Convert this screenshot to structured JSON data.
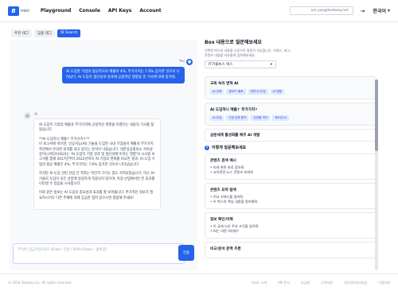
{
  "app": {
    "logo_mark": "B",
    "logo_text": "mini"
  },
  "nav": {
    "items": [
      "Playground",
      "Console",
      "API Keys",
      "Account"
    ],
    "email": "sm.yoo@testwoy.net",
    "language": "한국어"
  },
  "left": {
    "tabs": [
      "추천 태그",
      "맞춤 태그",
      "IB Search"
    ],
    "user_label": "You",
    "user_message": "AI 도입한 기업의 평균적으로 매출이 4%, 부가가치는 7.6% 증가한 것으로 나타났다. AI 도입이 생산성과 성과에 긍정적인 영향을 준 기사에 대해 알려줘.",
    "ai_label": "AI",
    "ai_paragraphs": [
      "AI 도입이 기업의 매출과 부가가치에 긍정적인 영향을 미쳤다는 내용의 기사를 찾았습니다.",
      "**AI 도입하니 매출↑ 부가가치↑**\n이 보고서에 따르면, 인공지능(AI) 기술을 도입한 국내 기업들이 매출과 부가가치 측면에서 유의한 성과를 내고 있다는 분석이 나왔습니다. 대한상공회의소 지속성장이니셔티브(SGI)는 'AI 도입이 기업 성과 및 생산성에 미치는 영향'의 시사점 보고서를 통해 2017년부터 2022년까지 AI 기업의 변화를 비교한 결과, AI 도입 기업의 평균 매출은 4%, 부가가치는 7.6% 증가한 것으로 나타났습니다.",
      "하지만 AI 도입 관련 산업 간 격차는 여전히 크다는 점도 지적되었습니다. 이는 AI 기술의 도입이 모든 산업에 동일하게 적용되지 않으며, 특정 산업에서만 큰 효과를 나타낼 수 있음을 시사합니다.",
      "이와 같은 정보는 AI 도입의 중요성과 효과를 잘 보여줍니다. 추가적인 정보가 필요하시거나 다른 주제에 대해 궁금한 점이 있으시면 말씀해 주세요!"
    ],
    "input_placeholder": "무엇이 궁금하신가요? (Enter: 전송 / Shift+Enter : 줄바꿈)",
    "send_label": "전송"
  },
  "right": {
    "title": "Box 내용으로 질문해보세요",
    "subtitle": "선택한 박스의 내용을 기준으로 질문이 가능합니다. 키워드, 태그, 콘텐츠 내용을 자유롭게 입력해보세요.",
    "select_value": "IT기술뉴스 박스",
    "groups": [
      {
        "title": "교육 속의 변혁 AI",
        "chips": [
          "AI 교육",
          "챗GPT 배포",
          "대학 AI 도입",
          "AI 영향"
        ]
      },
      {
        "title": "AI 도입하니 매출↑ 부가가치↑",
        "chips": [
          "AI 도입",
          "기업 성과 증가",
          "산업별 격차",
          "제조업 AI"
        ]
      }
    ],
    "plain_question": "삼분세계 활성화를 배추 AI 개발",
    "section_title": "이렇게 질문해보세요",
    "feature_cards": [
      {
        "title": "콘텐츠 검색 예시",
        "items": [
          "• 미래 관련 자료 찾아줘",
          "• 교육관련 뉴스 콘텐츠 보여줘"
        ]
      },
      {
        "title": "콘텐츠 요약 탐색",
        "items": [
          "• 주요 키워드를 알려줘",
          "• 이 박스의 핵심 내용을 정리해줘"
        ]
      },
      {
        "title": "정보 확인/이해",
        "items": [
          "• 이 글에 나온 주요 조건을 알려줘",
          "• AI는 어떤 의미야?"
        ]
      },
      {
        "title": "비교/분석 문맥 추론",
        "items": []
      }
    ]
  },
  "footer": {
    "copyright": "© 2024 Testway Inc. All rights reserved.",
    "links": [
      "서비스 소개",
      "API 문서",
      "요금제",
      "고객지원",
      "개인정보처리방침",
      "이용약관"
    ]
  }
}
